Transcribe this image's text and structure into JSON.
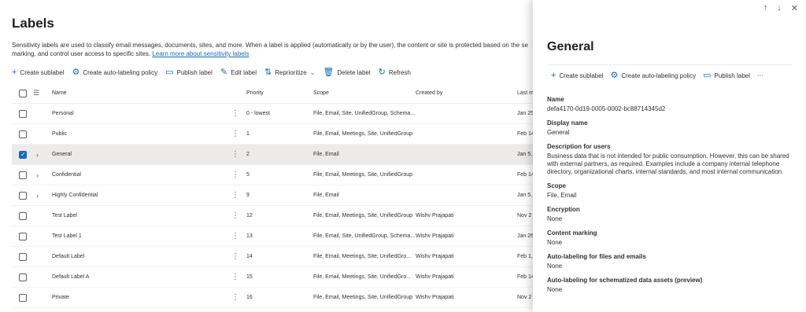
{
  "page": {
    "title": "Labels",
    "description": "Sensitivity labels are used to classify email messages, documents, sites, and more. When a label is applied (automatically or by the user), the content or site is protected based on the se",
    "description_line2": "marking, and control user access to specific sites.",
    "learn_more": "Learn more about sensitivity labels"
  },
  "toolbar": {
    "create_sublabel": "Create sublabel",
    "create_auto": "Create auto-labeling policy",
    "publish": "Publish label",
    "edit": "Edit label",
    "reprioritize": "Reprioritize",
    "delete": "Delete label",
    "refresh": "Refresh"
  },
  "table": {
    "headers": {
      "name": "Name",
      "priority": "Priority",
      "scope": "Scope",
      "created_by": "Created by",
      "last": "Last m"
    },
    "rows": [
      {
        "name": "Personal",
        "priority": "0 - lowest",
        "scope": "File, Email, Site, UnifiedGroup, Schema...",
        "created_by": "",
        "last": "Jan 25"
      },
      {
        "name": "Public",
        "priority": "1",
        "scope": "File, Email, Meetings, Site, UnifiedGroup",
        "created_by": "",
        "last": "Feb 14"
      },
      {
        "name": "General",
        "priority": "2",
        "scope": "File, Email",
        "created_by": "",
        "last": "Jan 5,",
        "selected": true
      },
      {
        "name": "Confidential",
        "priority": "5",
        "scope": "File, Email, Meetings, Site, UnifiedGroup",
        "created_by": "",
        "last": "Feb 14"
      },
      {
        "name": "Highly Confidential",
        "priority": "9",
        "scope": "File, Email",
        "created_by": "",
        "last": "Jan 5,"
      },
      {
        "name": "Test Label",
        "priority": "12",
        "scope": "File, Email, Meetings, Site, UnifiedGroup",
        "created_by": "Wishv Prajapati",
        "last": "Nov 2"
      },
      {
        "name": "Test Label 1",
        "priority": "13",
        "scope": "File, Email, Site, UnifiedGroup, Schema...",
        "created_by": "Wishv Prajapati",
        "last": "Jan 26"
      },
      {
        "name": "Default Label",
        "priority": "14",
        "scope": "File, Email, Meetings, Site, UnifiedGro...",
        "created_by": "Wishv Prajapati",
        "last": "Feb 1,"
      },
      {
        "name": "Default Label A",
        "priority": "15",
        "scope": "File, Email, Meetings, Site, UnifiedGro...",
        "created_by": "Wishv Prajapati",
        "last": "Feb 14"
      },
      {
        "name": "Private",
        "priority": "16",
        "scope": "File, Email, Meetings, Site, UnifiedGroup",
        "created_by": "Wishv Prajapati",
        "last": "Nov 2"
      }
    ]
  },
  "panel": {
    "title": "General",
    "toolbar": {
      "create_sublabel": "Create sublabel",
      "create_auto": "Create auto-labeling policy",
      "publish": "Publish label",
      "more": "···"
    },
    "fields": {
      "name_label": "Name",
      "name_value": "defa4170-0d19-0005-0002-bc88714345d2",
      "display_label": "Display name",
      "display_value": "General",
      "desc_label": "Description for users",
      "desc_value": "Business data that is not intended for public consumption. However, this can be shared with external partners, as required. Examples include a company internal telephone directory, organizational charts, internal standards, and most internal communication.",
      "scope_label": "Scope",
      "scope_value": "File, Email",
      "encryption_label": "Encryption",
      "encryption_value": "None",
      "content_label": "Content marking",
      "content_value": "None",
      "auto_files_label": "Auto-labeling for files and emails",
      "auto_files_value": "None",
      "auto_schema_label": "Auto-labeling for schematized data assets (preview)",
      "auto_schema_value": "None"
    }
  }
}
